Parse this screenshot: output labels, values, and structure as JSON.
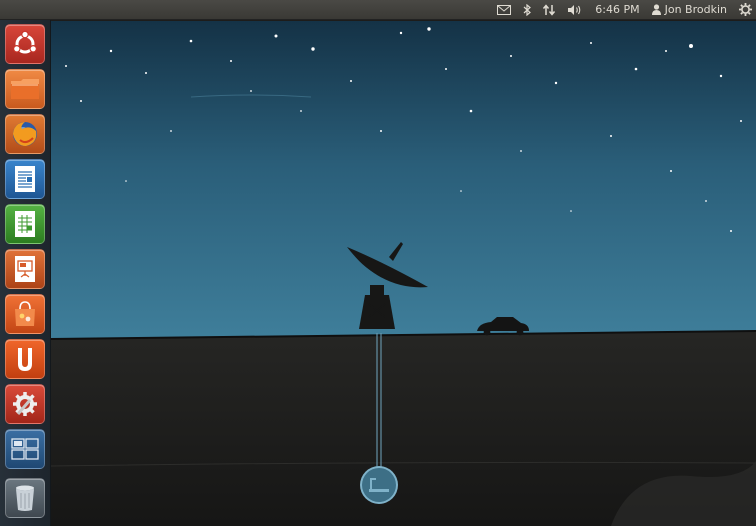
{
  "panel": {
    "clock": "6:46 PM",
    "user": "Jon Brodkin"
  },
  "indicators": [
    "mail-icon",
    "bluetooth-icon",
    "network-icon",
    "volume-icon",
    "user-icon",
    "session-gear-icon"
  ],
  "launcher": {
    "items": [
      {
        "name": "dash-home",
        "icon": "ubuntu-logo-icon",
        "color": "#c9352a"
      },
      {
        "name": "files",
        "icon": "folder-icon",
        "color": "#e3722e"
      },
      {
        "name": "firefox",
        "icon": "firefox-icon",
        "color": "#d6672a"
      },
      {
        "name": "libreoffice-writer",
        "icon": "writer-document-icon",
        "color": "#2a6fb5"
      },
      {
        "name": "libreoffice-calc",
        "icon": "calc-spreadsheet-icon",
        "color": "#3d9a2f"
      },
      {
        "name": "libreoffice-impress",
        "icon": "impress-presentation-icon",
        "color": "#d65b2a"
      },
      {
        "name": "software-center",
        "icon": "shopping-bag-icon",
        "color": "#e05a24"
      },
      {
        "name": "ubuntu-one",
        "icon": "ubuntu-one-icon",
        "color": "#e35a1e"
      },
      {
        "name": "system-settings",
        "icon": "settings-wrench-icon",
        "color": "#c9352a"
      },
      {
        "name": "workspace-switcher",
        "icon": "workspaces-icon",
        "color": "#2c5d8f"
      },
      {
        "name": "trash",
        "icon": "trash-icon",
        "color": "#5a6670"
      }
    ]
  },
  "colors": {
    "sky": "#3d7a96",
    "ground": "#1b1b1a",
    "panel": "#3c3b37",
    "launcher": "#28323c"
  }
}
